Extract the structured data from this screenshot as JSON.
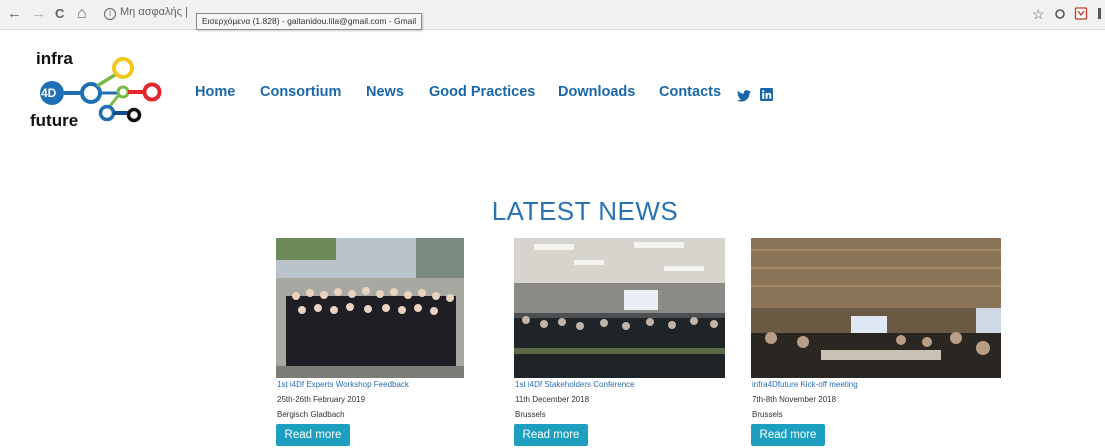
{
  "browser": {
    "back": "←",
    "forward": "→",
    "reload": "C",
    "home": "⌂",
    "address_prefix": "Μη ασφαλής",
    "address_tail": "",
    "tooltip": "Εισερχόμενα (1.828) - gaitanidou.lila@gmail.com - Gmail",
    "star": "☆"
  },
  "logo": {
    "word_top": "infra",
    "badge": "4D",
    "word_bottom": "future",
    "colors": {
      "blue": "#1f6fb5",
      "yellow": "#f2c918",
      "red": "#e3262e",
      "green": "#78b843",
      "darkblue": "#0e4d8f"
    }
  },
  "nav": {
    "items": [
      "Home",
      "Consortium",
      "News",
      "Good Practices",
      "Downloads",
      "Contacts"
    ],
    "social": [
      "twitter-icon",
      "linkedin-icon"
    ],
    "color": "#1a67a8"
  },
  "news": {
    "heading": "LATEST NEWS",
    "cards": [
      {
        "title": "1st i4Df Experts Workshop Feedback",
        "date": "25th-26th February 2019",
        "place": "Bergisch Gladbach",
        "button": "Read more"
      },
      {
        "title": "1st i4Df Stakeholders Conference",
        "date": "11th December 2018",
        "place": "Brussels",
        "button": "Read more"
      },
      {
        "title": "infra4Dfuture Kick-off meeting",
        "date": "7th-8th November 2018",
        "place": "Brussels",
        "button": "Read more"
      }
    ],
    "button_color": "#1d9fc0",
    "heading_color": "#2b73b3"
  }
}
